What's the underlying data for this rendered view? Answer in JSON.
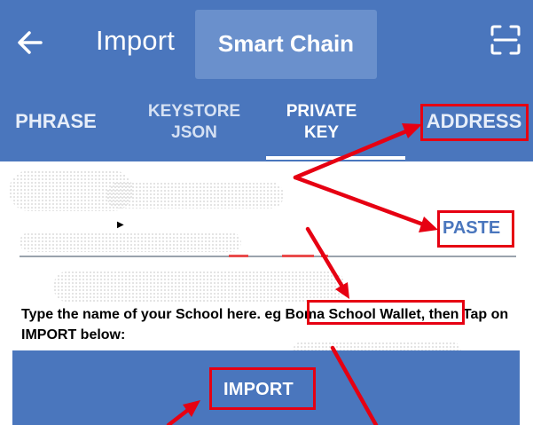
{
  "header": {
    "title": "Import",
    "chain_name": "Smart Chain",
    "back_icon": "arrow-left-icon",
    "scan_icon": "qr-scan-icon",
    "background_color": "#4a76bd"
  },
  "tabs": [
    {
      "label": "PHRASE",
      "active": false
    },
    {
      "label": "KEYSTORE\nJSON",
      "active": false
    },
    {
      "label": "PRIVATE\nKEY",
      "active": true
    },
    {
      "label": "ADDRESS",
      "active": false
    }
  ],
  "form": {
    "paste_label": "PASTE",
    "instruction_prefix": "Type the name of your School here. eg ",
    "instruction_example": "Boma School Wallet,",
    "instruction_suffix": " then Tap on IMPORT below:"
  },
  "import_button": {
    "label": "IMPORT"
  },
  "annotations": {
    "highlight_color": "#e60012",
    "highlighted": [
      "ADDRESS",
      "PASTE",
      "Boma School Wallet,",
      "IMPORT"
    ]
  }
}
